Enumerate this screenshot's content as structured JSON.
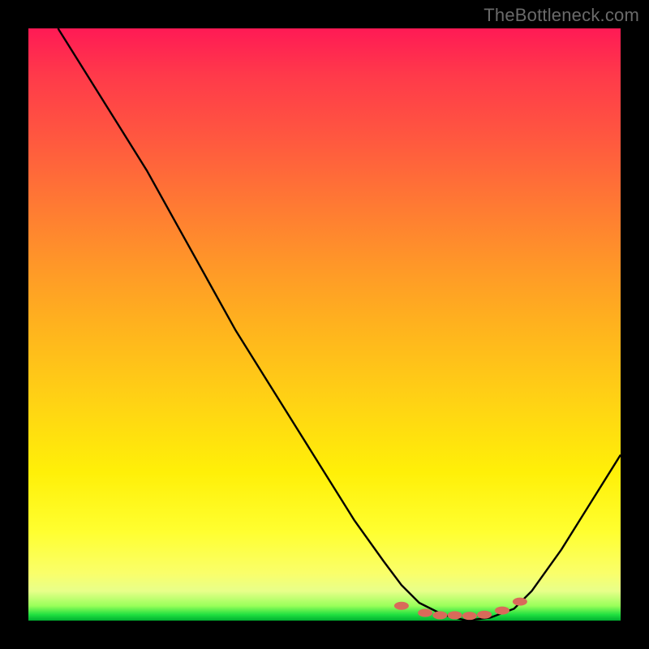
{
  "attribution": "TheBottleneck.com",
  "chart_data": {
    "type": "line",
    "title": "",
    "xlabel": "",
    "ylabel": "",
    "xlim": [
      0,
      100
    ],
    "ylim": [
      0,
      100
    ],
    "curve": [
      {
        "x": 5,
        "y": 100
      },
      {
        "x": 10,
        "y": 92
      },
      {
        "x": 15,
        "y": 84
      },
      {
        "x": 20,
        "y": 76
      },
      {
        "x": 25,
        "y": 67
      },
      {
        "x": 30,
        "y": 58
      },
      {
        "x": 35,
        "y": 49
      },
      {
        "x": 40,
        "y": 41
      },
      {
        "x": 45,
        "y": 33
      },
      {
        "x": 50,
        "y": 25
      },
      {
        "x": 55,
        "y": 17
      },
      {
        "x": 60,
        "y": 10
      },
      {
        "x": 63,
        "y": 6
      },
      {
        "x": 66,
        "y": 3
      },
      {
        "x": 70,
        "y": 1
      },
      {
        "x": 74,
        "y": 0
      },
      {
        "x": 78,
        "y": 0.5
      },
      {
        "x": 82,
        "y": 2
      },
      {
        "x": 85,
        "y": 5
      },
      {
        "x": 90,
        "y": 12
      },
      {
        "x": 95,
        "y": 20
      },
      {
        "x": 100,
        "y": 28
      }
    ],
    "markers": [
      {
        "x": 63,
        "y": 2.5
      },
      {
        "x": 67,
        "y": 1.3
      },
      {
        "x": 69.5,
        "y": 0.9
      },
      {
        "x": 72,
        "y": 0.9
      },
      {
        "x": 74.5,
        "y": 0.8
      },
      {
        "x": 77,
        "y": 1.0
      },
      {
        "x": 80,
        "y": 1.7
      },
      {
        "x": 83,
        "y": 3.2
      }
    ],
    "gradient_stops": [
      {
        "pct": 0,
        "color": "#ff1a55"
      },
      {
        "pct": 50,
        "color": "#ffb21e"
      },
      {
        "pct": 85,
        "color": "#ffff30"
      },
      {
        "pct": 100,
        "color": "#00b030"
      }
    ]
  }
}
